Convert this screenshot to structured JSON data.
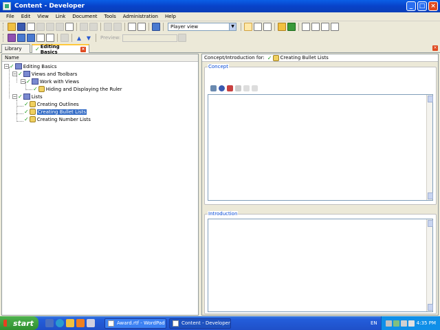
{
  "window": {
    "title": "Content - Developer",
    "controls": [
      "minimize",
      "maximize",
      "close"
    ]
  },
  "menu": {
    "items": [
      {
        "label": "File"
      },
      {
        "label": "Edit"
      },
      {
        "label": "View"
      },
      {
        "label": "Link"
      },
      {
        "label": "Document"
      },
      {
        "label": "Tools"
      },
      {
        "label": "Administration"
      },
      {
        "label": "Help"
      }
    ]
  },
  "toolbar": {
    "view_select": "Player view",
    "preview_label": "Preview:"
  },
  "tabs": {
    "library": "Library",
    "editing": "Editing Basics"
  },
  "tree": {
    "header": "Name",
    "nodes": [
      {
        "label": "Editing Basics",
        "level": 0
      },
      {
        "label": "Views and Toolbars",
        "level": 1
      },
      {
        "label": "Work with Views",
        "level": 2
      },
      {
        "label": "Hiding and Displaying the Ruler",
        "level": 3
      },
      {
        "label": "Lists",
        "level": 1
      },
      {
        "label": "Creating Outlines",
        "level": 2
      },
      {
        "label": "Creating Bullet Lists",
        "level": 2,
        "selected": true
      },
      {
        "label": "Creating Number Lists",
        "level": 2
      }
    ]
  },
  "right": {
    "header_prefix": "Concept/Introduction for:",
    "header_topic": "Creating Bullet Lists",
    "concept_label": "Concept",
    "introduction_label": "Introduction"
  },
  "taskbar": {
    "start": "start",
    "tasks": [
      {
        "label": "Award.rtf - WordPad",
        "active": false
      },
      {
        "label": "Content - Developer",
        "active": true
      }
    ],
    "lang": "EN",
    "clock": "4:35 PM"
  },
  "colors": {
    "titlebar": "#0a5fe6",
    "selection": "#316ac5",
    "group_label": "#0046d5",
    "check": "#1a9a1a"
  }
}
